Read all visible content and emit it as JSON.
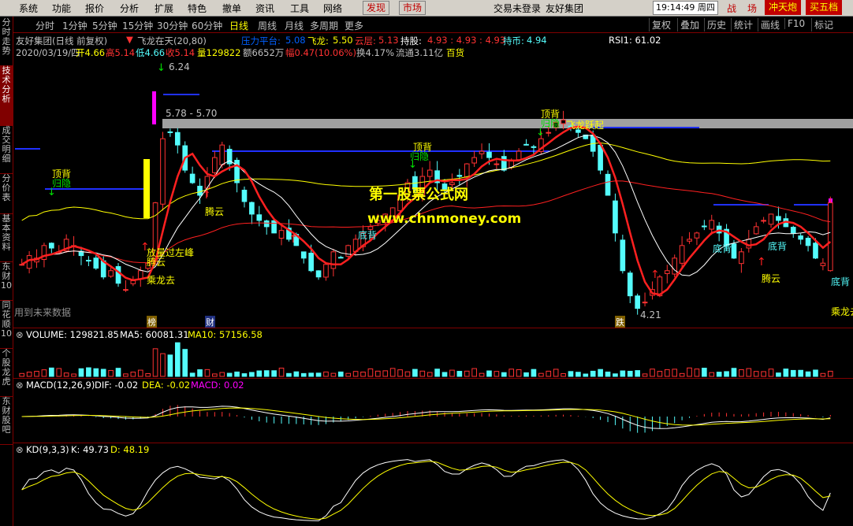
{
  "menu": {
    "items": [
      "系统",
      "功能",
      "报价",
      "分析",
      "扩展",
      "特色",
      "撤单",
      "资讯",
      "工具",
      "网络"
    ],
    "btn_warn": "发现",
    "btn_market": "市场",
    "status": "交易未登录",
    "stock_name": "友好集团",
    "clock": "19:14:49 周四",
    "hot": [
      "战",
      "场",
      "冲天炮",
      "买五档"
    ]
  },
  "toolbar": {
    "periods": [
      "分时",
      "1分钟",
      "5分钟",
      "15分钟",
      "30分钟",
      "60分钟",
      "日线",
      "周线",
      "月线",
      "多周期",
      "更多"
    ],
    "active_period": "日线",
    "right": [
      "复权",
      "叠加",
      "历史",
      "统计",
      "画线",
      "F10",
      "标记"
    ]
  },
  "sidetabs": [
    "分时走势",
    "技术分析",
    "成交明细",
    "分价表",
    "基本资料",
    "东财10",
    "同花顺10",
    "个股龙虎",
    "东财股吧"
  ],
  "quote": {
    "line1": {
      "title": "友好集团(日线 前复权)",
      "indicator": "飞龙在天(20,80)",
      "pressure_label": "压力平台:",
      "pressure_value": "5.08",
      "feilong_label": "飞龙:",
      "feilong_value": "5.50",
      "yunceng_label": "云层:",
      "yunceng_value": "5.13",
      "chigu_label": "持股:",
      "chigu_values": "4.93 : 4.93 : 4.93",
      "chibi_label": "持币:",
      "chibi_value": "4.94",
      "rsi": "RSI1: 61.02"
    },
    "line2": {
      "date": "2020/03/19/四",
      "open": "开4.66",
      "high": "高5.14",
      "low": "低4.66",
      "close": "收5.14",
      "volume": "量129822",
      "amount": "额6652万",
      "change": "幅0.47(10.06%)",
      "turnover": "换4.17%",
      "float": "流通3.11亿",
      "sector": "百货"
    }
  },
  "annotations": {
    "high_price": "6.24",
    "range": "5.78 - 5.70",
    "low_price": "4.21",
    "labels": [
      "顶背",
      "归隐",
      "顶背",
      "归隐",
      "顶背",
      "归隐",
      "飞龙跃起",
      "底背",
      "底背",
      "底背",
      "底背",
      "腾云",
      "腾云",
      "腾云",
      "放量过左峰",
      "乘龙去",
      "乘龙去"
    ],
    "future_data": "用到未来数据",
    "badge_bang": "榜",
    "badge_cai": "财",
    "badge_die": "跌",
    "watermark1": "第一股票公式网",
    "watermark2": "www.chnmoney.com"
  },
  "volume_panel": {
    "label": "VOLUME: 129821.85",
    "ma5": "MA5: 60081.31",
    "ma10": "MA10: 57156.58"
  },
  "macd_panel": {
    "label": "MACD(12,26,9)",
    "dif": "DIF: -0.02",
    "dea": "DEA: -0.02",
    "macd": "MACD: 0.02"
  },
  "kd_panel": {
    "label": "KD(9,3,3)",
    "k": "K: 49.73",
    "d": "D: 48.19"
  },
  "colors": {
    "up": "#ff3232",
    "down": "#54fcfc",
    "yellow": "#ffff00",
    "blue": "#0000ff",
    "grid": "#800000"
  },
  "chart_data": {
    "type": "candlestick",
    "closes": [
      4.65,
      4.72,
      4.7,
      4.8,
      4.78,
      4.75,
      4.85,
      4.8,
      4.72,
      4.68,
      4.62,
      4.55,
      4.6,
      4.5,
      4.45,
      4.52,
      4.6,
      4.66,
      5.14,
      5.65,
      5.7,
      5.6,
      5.4,
      5.3,
      5.2,
      5.35,
      5.5,
      5.6,
      5.45,
      5.3,
      5.15,
      5.05,
      5.0,
      4.95,
      4.9,
      4.92,
      4.85,
      4.8,
      4.7,
      4.6,
      4.55,
      4.65,
      4.75,
      4.7,
      4.8,
      4.85,
      4.9,
      4.95,
      5.0,
      5.05,
      5.1,
      5.2,
      5.3,
      5.25,
      5.35,
      5.4,
      5.3,
      5.25,
      5.3,
      5.35,
      5.45,
      5.5,
      5.55,
      5.5,
      5.45,
      5.4,
      5.48,
      5.55,
      5.6,
      5.58,
      5.65,
      5.7,
      5.78,
      5.8,
      5.75,
      5.7,
      5.65,
      5.55,
      5.4,
      5.2,
      4.9,
      4.6,
      4.4,
      4.3,
      4.35,
      4.45,
      4.55,
      4.6,
      4.7,
      4.8,
      4.85,
      4.9,
      4.95,
      5.0,
      4.9,
      4.8,
      4.7,
      4.75,
      4.85,
      4.95,
      5.0,
      5.05,
      5.0,
      4.95,
      4.9,
      4.85,
      4.8,
      4.7,
      4.66,
      5.14
    ],
    "price_high": 6.24,
    "price_low": 4.21
  }
}
